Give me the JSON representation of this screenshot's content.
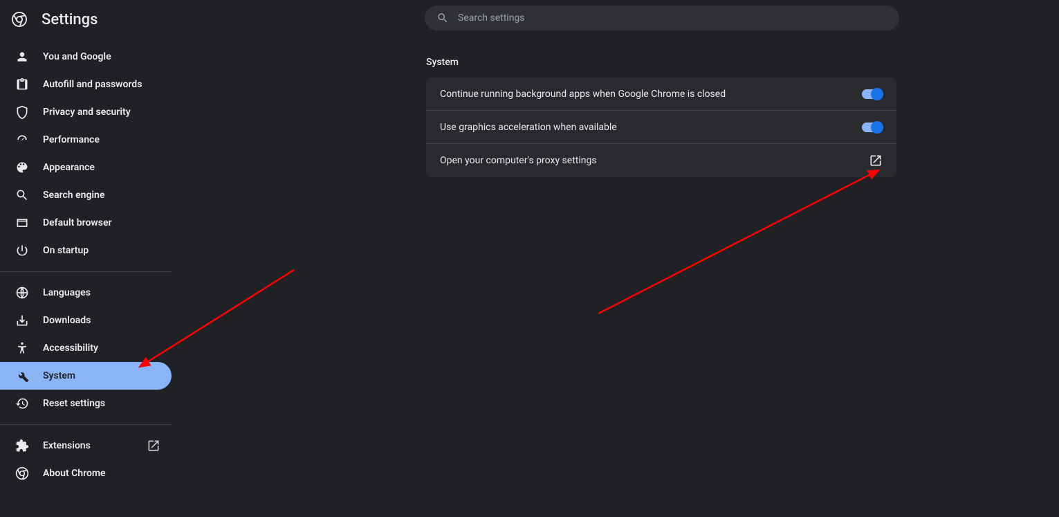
{
  "header": {
    "title": "Settings"
  },
  "search": {
    "placeholder": "Search settings"
  },
  "sidebar": {
    "groups": [
      [
        {
          "id": "you",
          "label": "You and Google",
          "icon": "person"
        },
        {
          "id": "autofill",
          "label": "Autofill and passwords",
          "icon": "clipboard"
        },
        {
          "id": "privacy",
          "label": "Privacy and security",
          "icon": "shield"
        },
        {
          "id": "performance",
          "label": "Performance",
          "icon": "speed"
        },
        {
          "id": "appearance",
          "label": "Appearance",
          "icon": "palette"
        },
        {
          "id": "search",
          "label": "Search engine",
          "icon": "search"
        },
        {
          "id": "default",
          "label": "Default browser",
          "icon": "browser"
        },
        {
          "id": "startup",
          "label": "On startup",
          "icon": "power"
        }
      ],
      [
        {
          "id": "languages",
          "label": "Languages",
          "icon": "globe"
        },
        {
          "id": "downloads",
          "label": "Downloads",
          "icon": "download"
        },
        {
          "id": "accessibility",
          "label": "Accessibility",
          "icon": "accessibility"
        },
        {
          "id": "system",
          "label": "System",
          "icon": "wrench",
          "selected": true
        },
        {
          "id": "reset",
          "label": "Reset settings",
          "icon": "history"
        }
      ],
      [
        {
          "id": "extensions",
          "label": "Extensions",
          "icon": "puzzle",
          "external": true
        },
        {
          "id": "about",
          "label": "About Chrome",
          "icon": "chrome"
        }
      ]
    ]
  },
  "main": {
    "section_title": "System",
    "rows": [
      {
        "label": "Continue running background apps when Google Chrome is closed",
        "type": "toggle",
        "value": true
      },
      {
        "label": "Use graphics acceleration when available",
        "type": "toggle",
        "value": true
      },
      {
        "label": "Open your computer's proxy settings",
        "type": "link"
      }
    ]
  }
}
